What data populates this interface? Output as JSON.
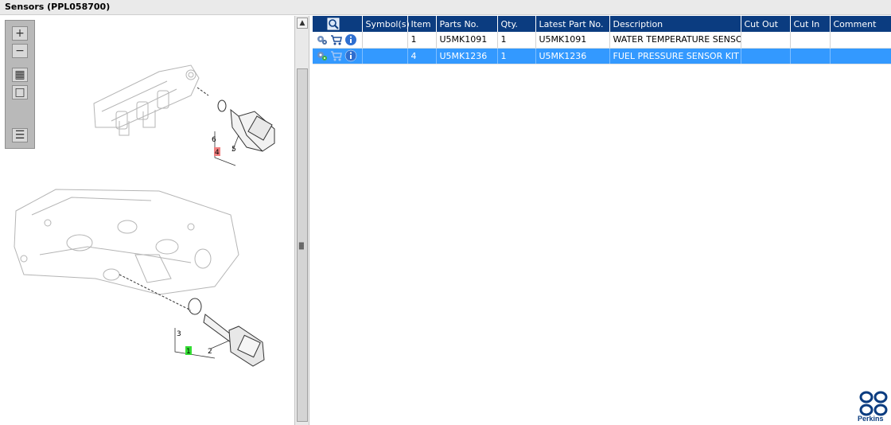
{
  "window": {
    "title": "Sensors (PPL058700)"
  },
  "diagram": {
    "callouts_top": {
      "ring": "6",
      "sensor": "5",
      "item": "4"
    },
    "callouts_bottom": {
      "ring": "3",
      "sensor": "2",
      "item": "1"
    },
    "colors": {
      "item_top": "#f08080",
      "item_bottom": "#33dd33"
    }
  },
  "toolbar": {
    "tools": [
      {
        "name": "zoom-in-icon",
        "glyph": "+"
      },
      {
        "name": "zoom-out-icon",
        "glyph": "−"
      },
      {
        "name": "fit-all-icon",
        "glyph": "▦"
      },
      {
        "name": "actual-size-icon",
        "glyph": "□"
      },
      {
        "name": "toggle-list-icon",
        "glyph": "☰"
      }
    ]
  },
  "table": {
    "columns": [
      "Symbol(s)",
      "Item",
      "Parts No.",
      "Qty.",
      "Latest Part No.",
      "Description",
      "Cut Out",
      "Cut In",
      "Comment"
    ],
    "rows": [
      {
        "item": "1",
        "part_no": "U5MK1091",
        "qty": "1",
        "latest_part_no": "U5MK1091",
        "description": "WATER TEMPERATURE SENSOR",
        "cut_out": "",
        "cut_in": "",
        "comment": "",
        "selected": false
      },
      {
        "item": "4",
        "part_no": "U5MK1236",
        "qty": "1",
        "latest_part_no": "U5MK1236",
        "description": "FUEL PRESSURE SENSOR KIT",
        "cut_out": "",
        "cut_in": "",
        "comment": "",
        "selected": true
      }
    ]
  },
  "brand": {
    "name": "Perkins",
    "color": "#0b3c80"
  },
  "theme": {
    "header_bg": "#0b3c80",
    "selected_bg": "#3399ff"
  }
}
